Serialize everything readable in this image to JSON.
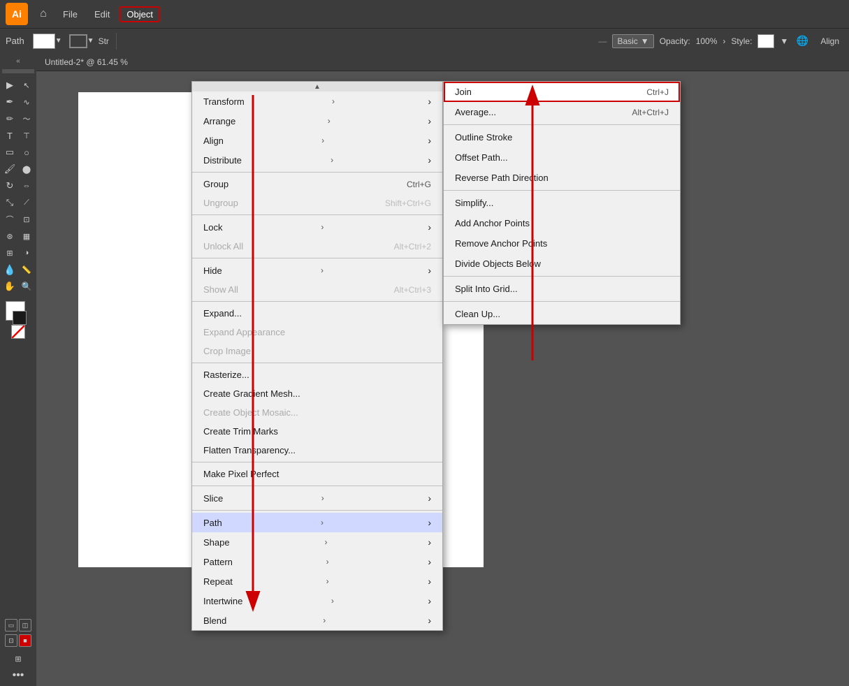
{
  "app": {
    "logo": "Ai",
    "title": "Untitled-2* @ 61.45 %"
  },
  "top_menu": {
    "file": "File",
    "edit": "Edit",
    "object": "Object"
  },
  "second_bar": {
    "path_label": "Path",
    "stroke_label": "Str",
    "basic": "Basic",
    "opacity_label": "Opacity:",
    "opacity_value": "100%",
    "style_label": "Style:",
    "align_label": "Align"
  },
  "object_menu": {
    "items": [
      {
        "label": "Transform",
        "shortcut": "",
        "has_arrow": true,
        "disabled": false
      },
      {
        "label": "Arrange",
        "shortcut": "",
        "has_arrow": true,
        "disabled": false
      },
      {
        "label": "Align",
        "shortcut": "",
        "has_arrow": true,
        "disabled": false
      },
      {
        "label": "Distribute",
        "shortcut": "",
        "has_arrow": true,
        "disabled": false
      },
      {
        "label": "Group",
        "shortcut": "Ctrl+G",
        "has_arrow": false,
        "disabled": false
      },
      {
        "label": "Ungroup",
        "shortcut": "Shift+Ctrl+G",
        "has_arrow": false,
        "disabled": true
      },
      {
        "label": "Lock",
        "shortcut": "",
        "has_arrow": true,
        "disabled": false
      },
      {
        "label": "Unlock All",
        "shortcut": "Alt+Ctrl+2",
        "has_arrow": false,
        "disabled": true
      },
      {
        "label": "Hide",
        "shortcut": "",
        "has_arrow": true,
        "disabled": false
      },
      {
        "label": "Show All",
        "shortcut": "Alt+Ctrl+3",
        "has_arrow": false,
        "disabled": true
      },
      {
        "label": "Expand...",
        "shortcut": "",
        "has_arrow": false,
        "disabled": false
      },
      {
        "label": "Expand Appearance",
        "shortcut": "",
        "has_arrow": false,
        "disabled": true
      },
      {
        "label": "Crop Image",
        "shortcut": "",
        "has_arrow": false,
        "disabled": true
      },
      {
        "label": "Rasterize...",
        "shortcut": "",
        "has_arrow": false,
        "disabled": false
      },
      {
        "label": "Create Gradient Mesh...",
        "shortcut": "",
        "has_arrow": false,
        "disabled": false
      },
      {
        "label": "Create Object Mosaic...",
        "shortcut": "",
        "has_arrow": false,
        "disabled": true
      },
      {
        "label": "Create Trim Marks",
        "shortcut": "",
        "has_arrow": false,
        "disabled": false
      },
      {
        "label": "Flatten Transparency...",
        "shortcut": "",
        "has_arrow": false,
        "disabled": false
      },
      {
        "label": "Make Pixel Perfect",
        "shortcut": "",
        "has_arrow": false,
        "disabled": false
      },
      {
        "label": "Slice",
        "shortcut": "",
        "has_arrow": true,
        "disabled": false
      },
      {
        "label": "Path",
        "shortcut": "",
        "has_arrow": true,
        "disabled": false,
        "highlighted": true
      },
      {
        "label": "Shape",
        "shortcut": "",
        "has_arrow": true,
        "disabled": false
      },
      {
        "label": "Pattern",
        "shortcut": "",
        "has_arrow": true,
        "disabled": false
      },
      {
        "label": "Repeat",
        "shortcut": "",
        "has_arrow": true,
        "disabled": false
      },
      {
        "label": "Intertwine",
        "shortcut": "",
        "has_arrow": true,
        "disabled": false
      },
      {
        "label": "Blend",
        "shortcut": "",
        "has_arrow": true,
        "disabled": false
      }
    ]
  },
  "path_submenu": {
    "items": [
      {
        "label": "Join",
        "shortcut": "Ctrl+J",
        "join_highlighted": true
      },
      {
        "label": "Average...",
        "shortcut": "Alt+Ctrl+J"
      },
      {
        "label": "Outline Stroke",
        "shortcut": ""
      },
      {
        "label": "Offset Path...",
        "shortcut": ""
      },
      {
        "label": "Reverse Path Direction",
        "shortcut": ""
      },
      {
        "label": "Simplify...",
        "shortcut": ""
      },
      {
        "label": "Add Anchor Points",
        "shortcut": ""
      },
      {
        "label": "Remove Anchor Points",
        "shortcut": ""
      },
      {
        "label": "Divide Objects Below",
        "shortcut": ""
      },
      {
        "label": "Split Into Grid...",
        "shortcut": ""
      },
      {
        "label": "Clean Up...",
        "shortcut": ""
      }
    ]
  },
  "tools": {
    "arrow": "▶",
    "direct_select": "↖",
    "pen": "✒",
    "text": "T",
    "rectangle": "▭",
    "ellipse": "○",
    "brush": "🖌",
    "pencil": "✏",
    "rotate": "↻",
    "scale": "⤡",
    "hand": "✋",
    "zoom": "🔍"
  }
}
